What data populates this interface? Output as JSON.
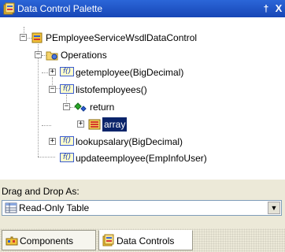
{
  "window": {
    "title": "Data Control Palette",
    "title_icon": "data-control-palette-icon",
    "pin_glyph": "†",
    "close_glyph": "X"
  },
  "tree": {
    "root": {
      "label": "PEmployeeServiceWsdlDataControl",
      "icon": "data-control-icon",
      "expander": "−"
    },
    "operations": {
      "label": "Operations",
      "icon": "operations-folder-icon",
      "expander": "−"
    },
    "methods": [
      {
        "label": "getemployee(BigDecimal)",
        "icon": "f()",
        "expander": "+"
      },
      {
        "label": "listofemployees()",
        "icon": "f()",
        "expander": "−"
      },
      {
        "label": "lookupsalary(BigDecimal)",
        "icon": "f()",
        "expander": "+"
      },
      {
        "label": "updateemployee(EmpInfoUser)",
        "icon": "f()",
        "expander": ""
      }
    ],
    "return_node": {
      "label": "return",
      "icon": "return-icon",
      "expander": "−"
    },
    "array_node": {
      "label": "array",
      "icon": "array-icon",
      "expander": "+",
      "selected": true
    }
  },
  "dragdrop": {
    "label": "Drag and Drop As:",
    "selected": "Read-Only Table",
    "icon": "table-icon",
    "arrow": "▼"
  },
  "tabs": [
    {
      "label": "Components",
      "icon": "components-icon",
      "active": false
    },
    {
      "label": "Data Controls",
      "icon": "data-controls-icon",
      "active": true
    }
  ],
  "colors": {
    "titlebar": "#1f55c8",
    "selection": "#0a246a",
    "panel": "#ece9d8"
  }
}
